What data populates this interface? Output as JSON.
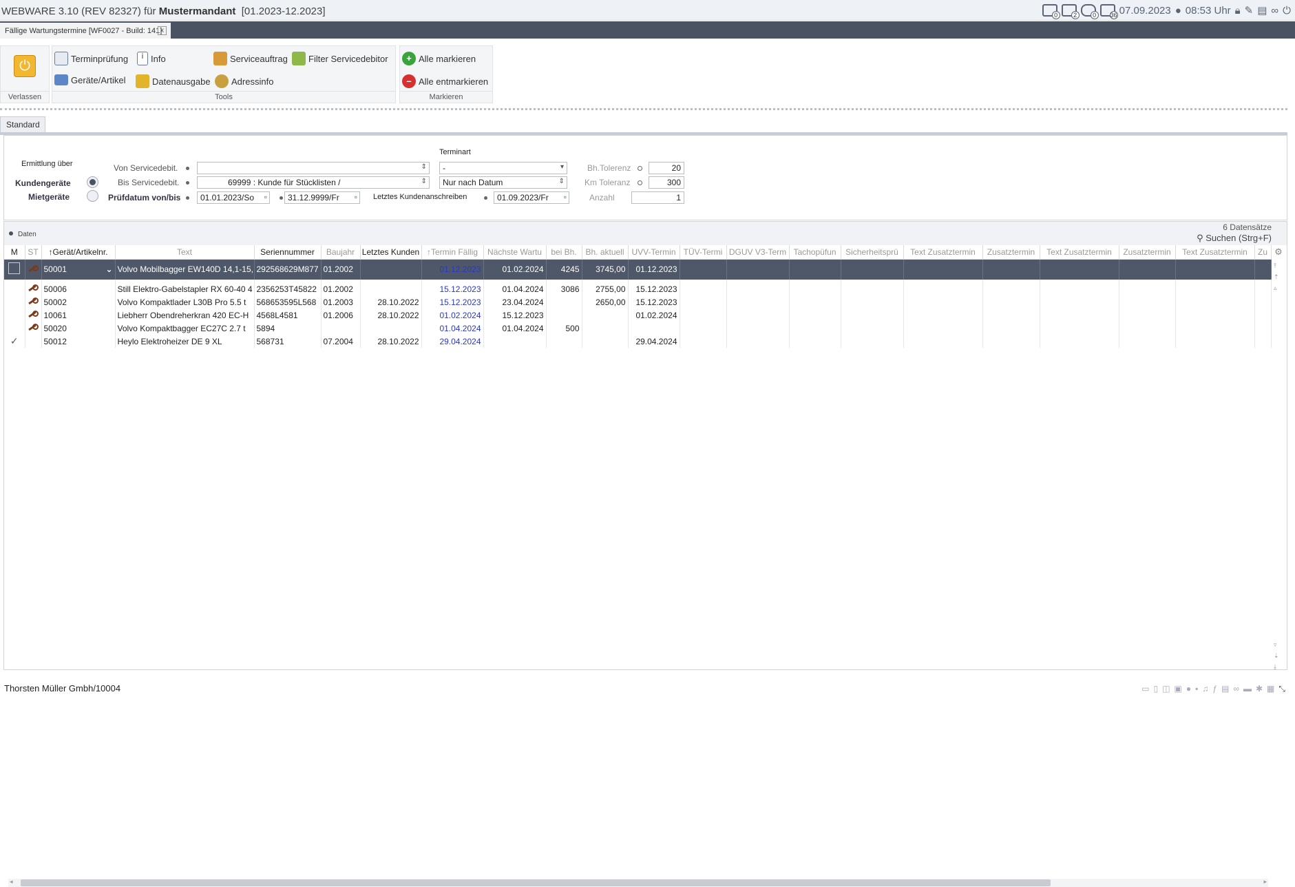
{
  "app": {
    "title": "WEBWARE 3.10 (REV 82327) für",
    "tenant": "Mustermandant",
    "period": "[01.2023-12.2023]",
    "date": "07.09.2023",
    "time": "08:53 Uhr",
    "badges": [
      "0",
      "2",
      "0",
      "36"
    ]
  },
  "tab": {
    "label": "Fällige Wartungstermine [WF0027 - Build: 141]",
    "close": "x"
  },
  "ribbon": {
    "verlassen": "Verlassen",
    "tools": "Tools",
    "markieren": "Markieren",
    "terminpruefung": "Terminprüfung",
    "info": "Info",
    "serviceauftrag": "Serviceauftrag",
    "filter_servicedebitor": "Filter Servicedebitor",
    "geraete_artikel": "Geräte/Artikel",
    "datenausgabe": "Datenausgabe",
    "adressinfo": "Adressinfo",
    "alle_markieren": "Alle markieren",
    "alle_entmarkieren": "Alle entmarkieren"
  },
  "std_tab": "Standard",
  "filter": {
    "ermittlung": "Ermittlung über",
    "kundengeraete": "Kundengeräte",
    "mietgeraete": "Mietgeräte",
    "von": "Von Servicedebit.",
    "bis": "Bis Servicedebit.",
    "pruefdatum": "Prüfdatum von/bis",
    "von_value": "",
    "bis_value": "69999  : Kunde für Stücklisten /",
    "datum_von": "01.01.2023/So",
    "datum_bis": "31.12.9999/Fr",
    "terminart": "Terminart",
    "terminart_value": "-",
    "datum_mode": "Nur nach Datum",
    "letztes": "Letztes Kundenanschreiben",
    "letztes_value": "01.09.2023/Fr",
    "bh_tol": "Bh.Tolerenz",
    "bh_tol_value": "20",
    "km_tol": "Km Toleranz",
    "km_tol_value": "300",
    "anzahl": "Anzahl",
    "anzahl_value": "1"
  },
  "data": {
    "label": "Daten",
    "count": "6 Datensätze",
    "search": "Suchen (Strg+F)",
    "columns": [
      "M",
      "ST",
      "↑Gerät/Artikelnr.",
      "Text",
      "Seriennummer",
      "Baujahr",
      "Letztes Kunden",
      "↑Termin Fällig",
      "Nächste Wartu",
      "bei Bh.",
      "Bh. aktuell",
      "UVV-Termin",
      "TÜV-Termi",
      "DGUV V3-Term",
      "Tachopüfun",
      "Sicherheitsprü",
      "Text Zusatztermin",
      "Zusatztermin",
      "Text Zusatztermin",
      "Zusatztermin",
      "Text Zusatztermin",
      "Zu"
    ],
    "rows": [
      {
        "nr": "50001",
        "text": "Volvo Mobilbagger EW140D 14,1-15,",
        "sn": "292568629M877",
        "bj": "01.2002",
        "lk": "",
        "tf": "01.12.2023",
        "nw": "01.02.2024",
        "bh": "4245",
        "bha": "3745,00",
        "uvv": "01.12.2023"
      },
      {
        "nr": "50006",
        "text": "Still Elektro-Gabelstapler RX 60-40 4",
        "sn": "2356253T45822",
        "bj": "01.2002",
        "lk": "",
        "tf": "15.12.2023",
        "nw": "01.04.2024",
        "bh": "3086",
        "bha": "2755,00",
        "uvv": "15.12.2023"
      },
      {
        "nr": "50002",
        "text": "Volvo Kompaktlader L30B Pro 5.5 t",
        "sn": "568653595L568",
        "bj": "01.2003",
        "lk": "28.10.2022",
        "tf": "15.12.2023",
        "nw": "23.04.2024",
        "bh": "",
        "bha": "2650,00",
        "uvv": "15.12.2023"
      },
      {
        "nr": "10061",
        "text": "Liebherr Obendreherkran 420 EC-H",
        "sn": "4568L4581",
        "bj": "01.2006",
        "lk": "28.10.2022",
        "tf": "01.02.2024",
        "nw": "15.12.2023",
        "bh": "",
        "bha": "",
        "uvv": "01.02.2024"
      },
      {
        "nr": "50020",
        "text": "Volvo Kompaktbagger EC27C 2.7 t",
        "sn": "5894",
        "bj": "",
        "lk": "",
        "tf": "01.04.2024",
        "nw": "01.04.2024",
        "bh": "500",
        "bha": "",
        "uvv": ""
      },
      {
        "nr": "50012",
        "text": "Heylo Elektroheizer DE 9 XL",
        "sn": "568731",
        "bj": "07.2004",
        "lk": "28.10.2022",
        "tf": "29.04.2024",
        "nw": "",
        "bh": "",
        "bha": "",
        "uvv": "29.04.2024"
      }
    ]
  },
  "status": {
    "user": "Thorsten Müller Gmbh/10004"
  },
  "colors": {
    "accent": "#4a5362",
    "selected_row": "#4e5868",
    "blue_date": "#2a37c8"
  }
}
